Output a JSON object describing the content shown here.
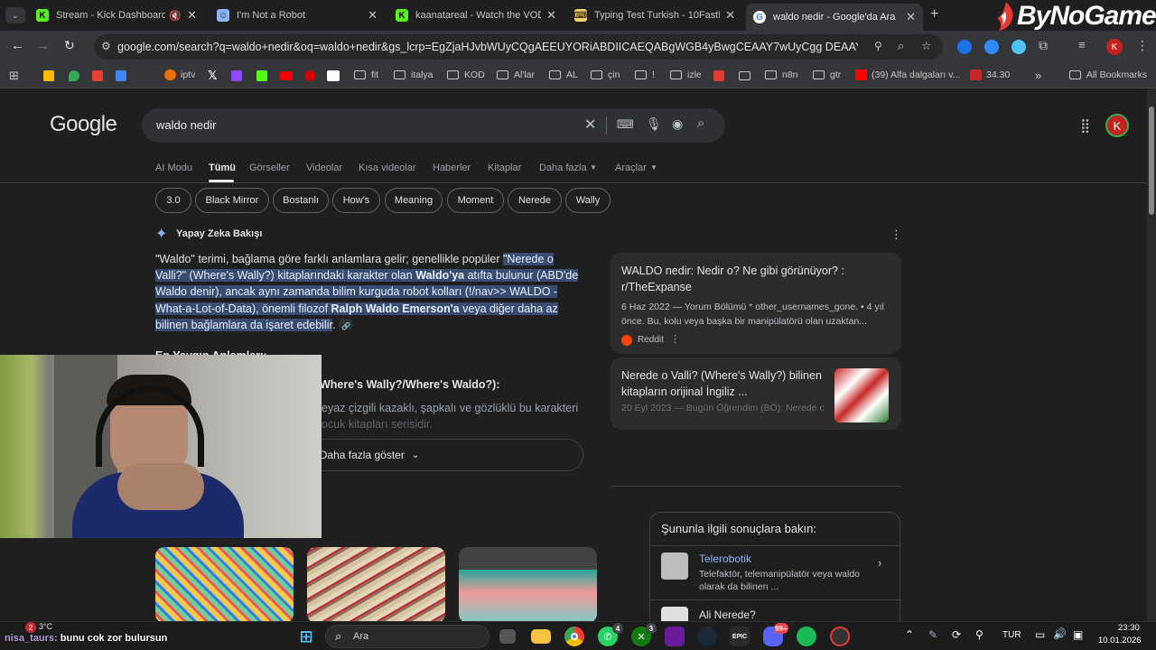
{
  "browser": {
    "tabs": [
      {
        "title": "Stream - Kick Dashboard",
        "icon": "kick-icon"
      },
      {
        "title": "I'm Not a Robot",
        "icon": "robot-icon"
      },
      {
        "title": "kaanatareal - Watch the VOD o",
        "icon": "kick-icon"
      },
      {
        "title": "Typing Test Turkish - 10FastFing",
        "icon": "10fastfingers-icon"
      },
      {
        "title": "waldo nedir - Google'da Ara",
        "icon": "google-icon",
        "active": true
      }
    ],
    "url": "google.com/search?q=waldo+nedir&oq=waldo+nedir&gs_lcrp=EgZjaHJvbWUyCQgAEEUYORiABDIICAEQABgWGB4yBwgCEAAY7wUyCgg DEAAYgAQYogQyCg...",
    "profile_initial": "K",
    "bookmarks": [
      "iptv",
      "fit",
      "italya",
      "KOD",
      "Al'lar",
      "AL",
      "çin",
      "!",
      "izle",
      "n8n",
      "gtr",
      "(39) Alfa dalgaları v...",
      "34.30"
    ],
    "all_bookmarks": "All Bookmarks"
  },
  "watermark": "ByNoGame",
  "google": {
    "logo": "Google",
    "query": "waldo nedir",
    "tabs": [
      "AI Modu",
      "Tümü",
      "Görseller",
      "Videolar",
      "Kısa videolar",
      "Haberler",
      "Kitaplar",
      "Daha fazla",
      "Araçlar"
    ],
    "active_tab": "Tümü",
    "chips": [
      "3.0",
      "Black Mirror",
      "Bostanlı",
      "How's",
      "Meaning",
      "Moment",
      "Nerede",
      "Wally"
    ],
    "ai_overview": {
      "heading": "Yapay Zeka Bakışı",
      "p1": "\"Waldo\" terimi, bağlama göre farklı anlamlara gelir; genellikle popüler ",
      "p1_hl": "\"Nerede o Valli?\" (Where's Wally?) kitaplarındaki karakter olan ",
      "p1_b1": "Waldo'ya",
      "p1_hl2": " atıfta bulunur (ABD'de Waldo denir), ancak aynı zamanda bilim kurguda robot kolları (!/nav>> WALDO - What-a-Lot-of-Data), önemli filozof ",
      "p1_b2": "Ralph Waldo Emerson'a",
      "p1_hl3": " veya diğer daha az bilinen bağlamlara da işaret edebilir",
      "sub_heading": "En Yaygın Anlamları:",
      "item_title": "Where's Wally?/Where's Waldo?):",
      "item_text1": "eyaz çizgili kazaklı, şapkalı ve gözlüklü bu karakteri",
      "item_text2": "ocuk kitapları serisidir.",
      "show_more": "Daha fazla göster"
    },
    "sources": [
      {
        "title": "WALDO nedir: Nedir o? Ne gibi görünüyor? : r/TheExpanse",
        "snippet": "6 Haz 2022 — Yorum Bölümü * other_usernames_gone. • 4 yıl önce. Bu, kolu veya başka bir manipülatörü olan uzaktan...",
        "site": "Reddit"
      },
      {
        "title": "Nerede o Valli? (Where's Wally?) bilinen kitapların orijinal İngiliz ...",
        "snippet": "20 Eyl 2023 — Bugün Öğrendim (BÖ): Nerede o"
      }
    ],
    "related": {
      "heading": "Şununla ilgili sonuçlara bakın:",
      "items": [
        {
          "title": "Telerobotik",
          "desc": "Telefaktör, telemanipülatör veya waldo olarak da bilinen ..."
        },
        {
          "title": "Ali Nerede?",
          "desc": ""
        }
      ]
    }
  },
  "overlay": {
    "chat_user": "nisa_taurs:",
    "chat_message": "bunu cok zor bulursun"
  },
  "taskbar": {
    "weather": "3°C",
    "weather_badge": "2",
    "search_placeholder": "Ara",
    "language": "TUR",
    "time": "23:30",
    "date": "10.01.2026",
    "badges": {
      "whatsapp": "4",
      "xbox": "3",
      "discord": "99+"
    }
  },
  "colors": {
    "accent": "#8ab4f8",
    "highlight": "#394b70",
    "kick": "#53fc18"
  }
}
